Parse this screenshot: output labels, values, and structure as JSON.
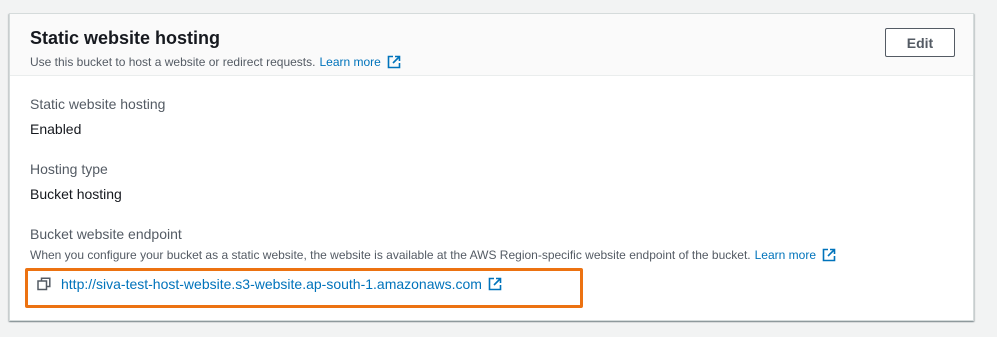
{
  "section": {
    "title": "Static website hosting",
    "description": "Use this bucket to host a website or redirect requests.",
    "learn_more": "Learn more",
    "edit_label": "Edit"
  },
  "fields": {
    "hosting": {
      "label": "Static website hosting",
      "value": "Enabled"
    },
    "hosting_type": {
      "label": "Hosting type",
      "value": "Bucket hosting"
    },
    "endpoint": {
      "label": "Bucket website endpoint",
      "description": "When you configure your bucket as a static website, the website is available at the AWS Region-specific website endpoint of the bucket.",
      "learn_more": "Learn more",
      "url": "http://siva-test-host-website.s3-website.ap-south-1.amazonaws.com"
    }
  },
  "icons": {
    "external": "external-link-icon",
    "copy": "copy-icon"
  },
  "colors": {
    "link": "#0073bb",
    "highlight": "#ec7211",
    "header_bg": "#fafafa",
    "page_bg": "#f2f3f3"
  }
}
